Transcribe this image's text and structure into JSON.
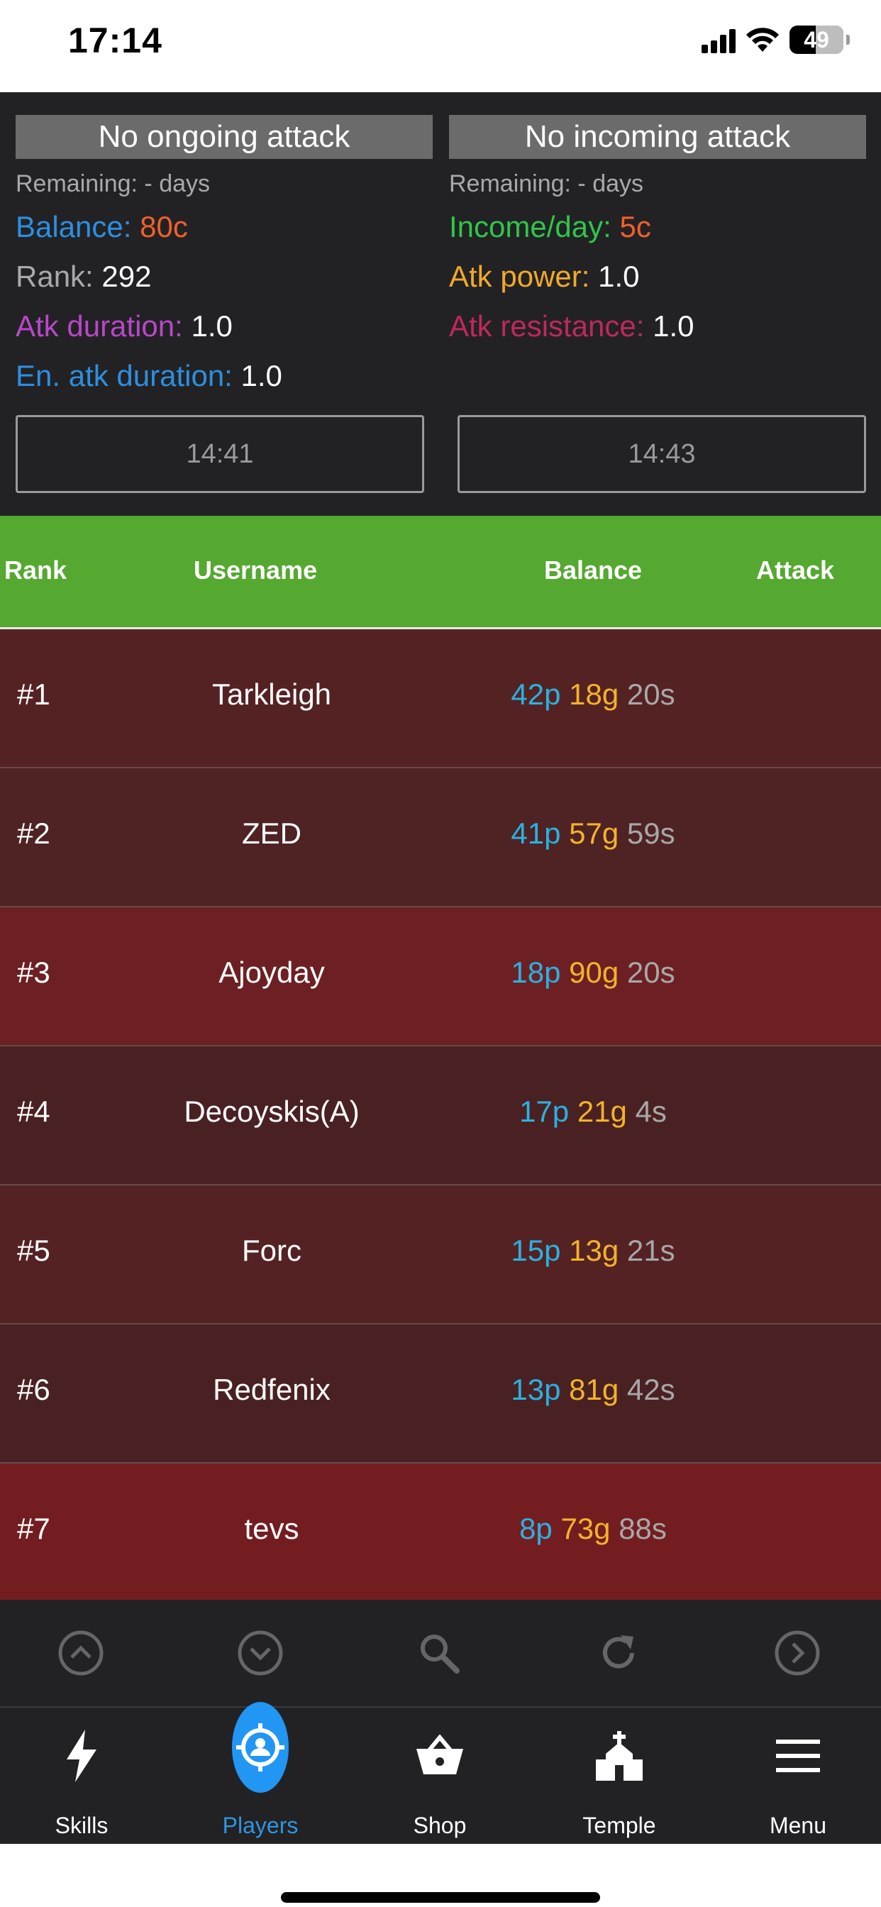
{
  "status_bar": {
    "time": "17:14",
    "battery": "49",
    "battery_level_percent": 49
  },
  "left_panel": {
    "banner": "No ongoing attack",
    "remaining": "Remaining: - days",
    "stats": [
      {
        "label": "Balance: ",
        "value": "80c",
        "label_color": "#2d8fe0",
        "value_color": "#f0602a"
      },
      {
        "label": "Rank: ",
        "value": "292",
        "label_color": "#a9a9a9",
        "value_color": "#ffffff"
      },
      {
        "label": "Atk duration: ",
        "value": "1.0",
        "label_color": "#b947c9",
        "value_color": "#ffffff"
      },
      {
        "label": "En. atk duration: ",
        "value": "1.0",
        "label_color": "#2d8fe0",
        "value_color": "#ffffff"
      }
    ],
    "time_button": "14:41"
  },
  "right_panel": {
    "banner": "No incoming attack",
    "remaining": "Remaining: - days",
    "stats": [
      {
        "label": "Income/day: ",
        "value": "5c",
        "label_color": "#2fc64a",
        "value_color": "#f0602a"
      },
      {
        "label": "Atk power: ",
        "value": "1.0",
        "label_color": "#f2a92a",
        "value_color": "#ffffff"
      },
      {
        "label": "Atk resistance: ",
        "value": "1.0",
        "label_color": "#c0285a",
        "value_color": "#ffffff"
      }
    ],
    "time_button": "14:43"
  },
  "table": {
    "headers": {
      "rank": "Rank",
      "username": "Username",
      "balance": "Balance",
      "attack": "Attack"
    },
    "rows": [
      {
        "rank": "#1",
        "username": "Tarkleigh",
        "p": "42p",
        "g": "18g",
        "s": "20s",
        "bg": "#552224"
      },
      {
        "rank": "#2",
        "username": "ZED",
        "p": "41p",
        "g": "57g",
        "s": "59s",
        "bg": "#4f2224"
      },
      {
        "rank": "#3",
        "username": "Ajoyday",
        "p": "18p",
        "g": "90g",
        "s": "20s",
        "bg": "#6d2023"
      },
      {
        "rank": "#4",
        "username": "Decoyskis(A)",
        "p": "17p",
        "g": "21g",
        "s": "4s",
        "bg": "#4a2123"
      },
      {
        "rank": "#5",
        "username": "Forc",
        "p": "15p",
        "g": "13g",
        "s": "21s",
        "bg": "#552224"
      },
      {
        "rank": "#6",
        "username": "Redfenix",
        "p": "13p",
        "g": "81g",
        "s": "42s",
        "bg": "#4a2123"
      },
      {
        "rank": "#7",
        "username": "tevs",
        "p": "8p",
        "g": "73g",
        "s": "88s",
        "bg": "#731d21"
      }
    ]
  },
  "toolbar": {
    "icons": [
      "scroll-up-icon",
      "scroll-down-icon",
      "search-icon",
      "refresh-icon",
      "next-icon"
    ]
  },
  "tabbar": {
    "tabs": [
      {
        "label": "Skills",
        "icon": "lightning-icon"
      },
      {
        "label": "Players",
        "icon": "crosshair-person-icon",
        "active": true
      },
      {
        "label": "Shop",
        "icon": "basket-icon"
      },
      {
        "label": "Temple",
        "icon": "temple-icon"
      },
      {
        "label": "Menu",
        "icon": "menu-icon"
      }
    ]
  }
}
